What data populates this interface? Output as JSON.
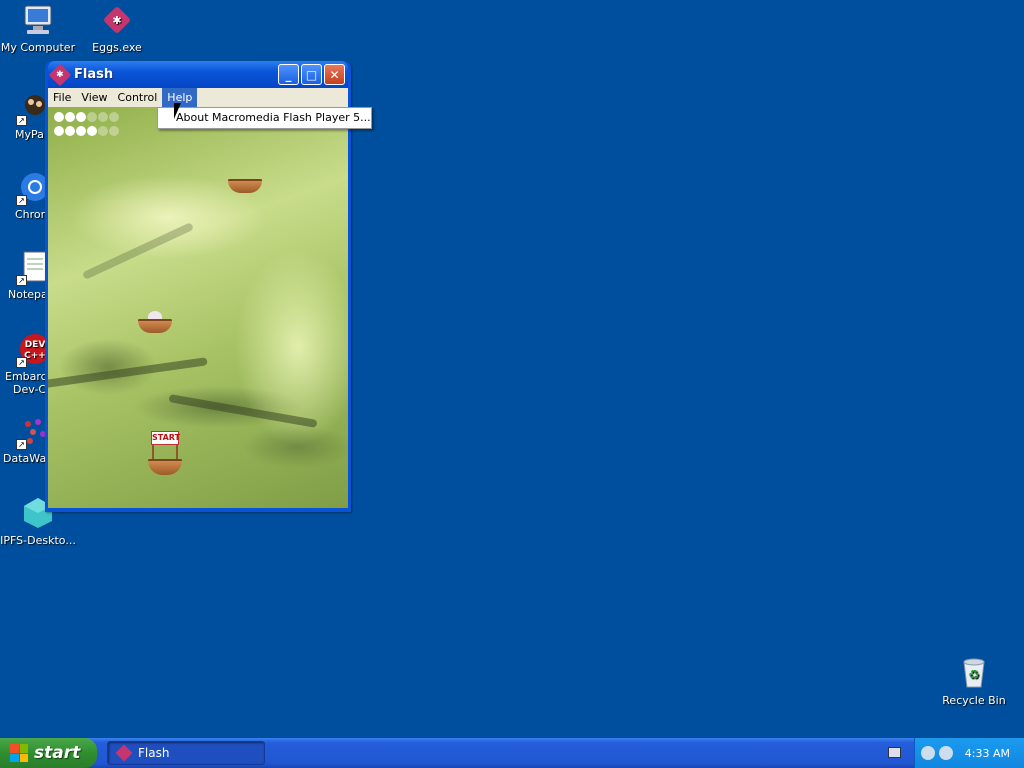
{
  "desktop": {
    "icons": [
      {
        "label": "My Computer",
        "icon": "computer-icon"
      },
      {
        "label": "Eggs.exe",
        "icon": "flash-app-icon"
      },
      {
        "label": "MyPa",
        "icon": "folder-icon"
      },
      {
        "label": "Chron",
        "icon": "chrome-icon"
      },
      {
        "label": "Notepa",
        "icon": "notepad-icon"
      },
      {
        "label": "Embarca",
        "label2": "Dev-C",
        "icon": "devcpp-icon"
      },
      {
        "label": "DataWa",
        "icon": "datawarrior-icon"
      },
      {
        "label": "IPFS-Deskto...",
        "icon": "ipfs-icon"
      },
      {
        "label": "Recycle Bin",
        "icon": "recycle-bin-icon"
      }
    ]
  },
  "window": {
    "title": "Flash",
    "menu": [
      "File",
      "View",
      "Control",
      "Help"
    ],
    "active_menu": "Help",
    "dropdown_item": "About Macromedia Flash Player 5...",
    "buttons": {
      "minimize": "_",
      "maximize": "□",
      "close": "✕"
    }
  },
  "game": {
    "lives_total": 12,
    "lives_remaining": 5,
    "start_label": "START"
  },
  "taskbar": {
    "start_label": "start",
    "task_label": "Flash",
    "clock": "4:33 AM"
  },
  "colors": {
    "desktop": "#004f9e",
    "titlebar": "#0a56d8",
    "start_button": "#2f8f2f"
  }
}
